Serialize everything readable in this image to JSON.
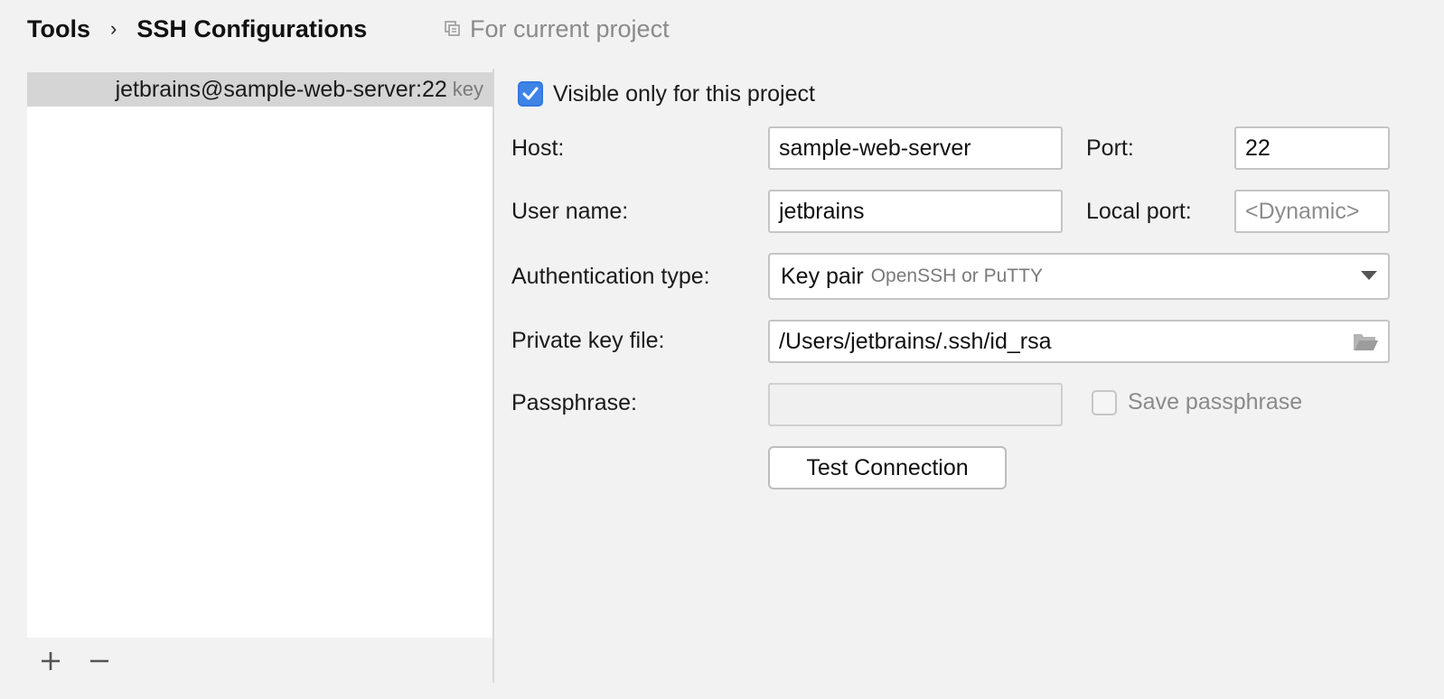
{
  "header": {
    "breadcrumb": [
      "Tools",
      "SSH Configurations"
    ],
    "separator": "›",
    "scope_label": "For current project"
  },
  "config_list": {
    "items": [
      {
        "name": "jetbrains@sample-web-server:22",
        "tag": "key",
        "selected": true
      }
    ],
    "add_label": "+",
    "remove_label": "−"
  },
  "form": {
    "visible_only": {
      "label": "Visible only for this project",
      "checked": true
    },
    "host": {
      "label": "Host:",
      "value": "sample-web-server"
    },
    "port": {
      "label": "Port:",
      "value": "22"
    },
    "user_name": {
      "label": "User name:",
      "value": "jetbrains"
    },
    "local_port": {
      "label": "Local port:",
      "placeholder": "<Dynamic>"
    },
    "auth_type": {
      "label": "Authentication type:",
      "value": "Key pair",
      "hint": "OpenSSH or PuTTY"
    },
    "private_key": {
      "label": "Private key file:",
      "value": "/Users/jetbrains/.ssh/id_rsa"
    },
    "passphrase": {
      "label": "Passphrase:",
      "value": ""
    },
    "save_passphrase": {
      "label": "Save passphrase",
      "checked": false
    },
    "test_button": "Test Connection"
  },
  "colors": {
    "accent": "#3d84e6",
    "background": "#f2f2f2",
    "selection": "#d5d5d5"
  },
  "icons": {
    "scope": "copy-icon",
    "browse": "folder-open-icon",
    "dropdown": "chevron-down-icon"
  }
}
